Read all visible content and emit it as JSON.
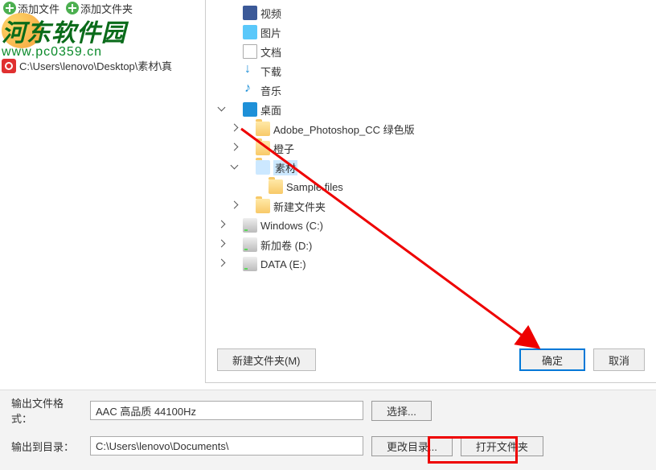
{
  "toolbar": {
    "add_file": "添加文件",
    "add_folder": "添加文件夹"
  },
  "watermark": {
    "title": "河东软件园",
    "url": "www.pc0359.cn"
  },
  "file_path": "C:\\Users\\lenovo\\Desktop\\素材\\真",
  "tree": {
    "video": "视频",
    "pictures": "图片",
    "documents": "文档",
    "downloads": "下载",
    "music": "音乐",
    "desktop": "桌面",
    "ps": "Adobe_Photoshop_CC 绿色版",
    "orange": "橙子",
    "sucai": "素材",
    "sample": "Sample.files",
    "newfolder": "新建文件夹",
    "winc": "Windows (C:)",
    "xinjia": "新加卷 (D:)",
    "datae": "DATA (E:)"
  },
  "dialog": {
    "new_folder": "新建文件夹(M)",
    "ok": "确定",
    "cancel": "取消"
  },
  "bottom": {
    "format_label": "输出文件格式：",
    "format_value": "AAC 高品质 44100Hz",
    "select": "选择...",
    "dir_label": "输出到目录：",
    "dir_value": "C:\\Users\\lenovo\\Documents\\",
    "change": "更改目录...",
    "open": "打开文件夹"
  }
}
